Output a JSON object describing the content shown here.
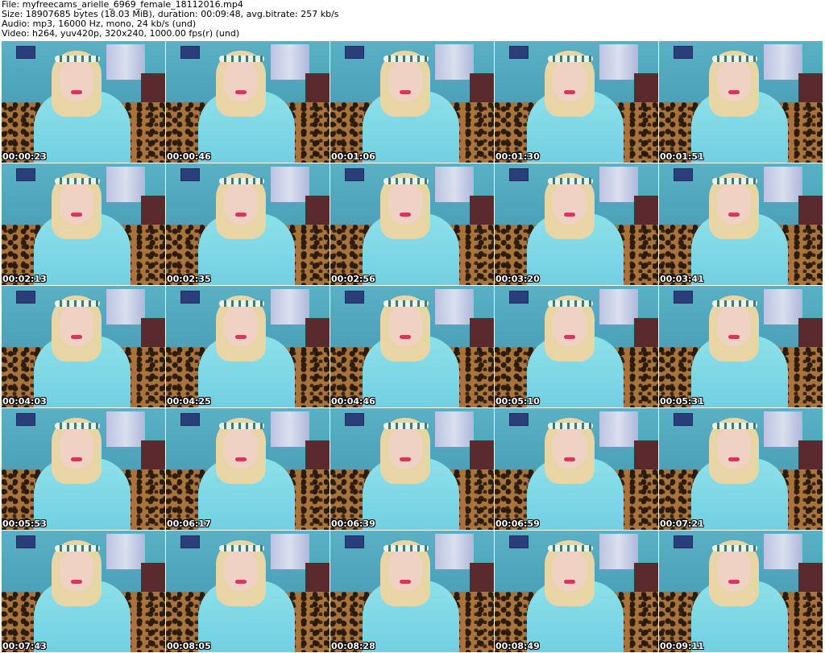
{
  "header": {
    "file_line": "File: myfreecams_arielle_6969_female_18112016.mp4",
    "size_line": "Size: 18907685 bytes (18.03 MiB), duration: 00:09:48, avg.bitrate: 257 kb/s",
    "audio_line": "Audio: mp3, 16000 Hz, mono, 24 kb/s (und)",
    "video_line": "Video: h264, yuv420p, 320x240, 1000.00 fps(r) (und)"
  },
  "thumbnails": [
    {
      "timestamp": "00:00:23"
    },
    {
      "timestamp": "00:00:46"
    },
    {
      "timestamp": "00:01:06"
    },
    {
      "timestamp": "00:01:30"
    },
    {
      "timestamp": "00:01:51"
    },
    {
      "timestamp": "00:02:13"
    },
    {
      "timestamp": "00:02:35"
    },
    {
      "timestamp": "00:02:56"
    },
    {
      "timestamp": "00:03:20"
    },
    {
      "timestamp": "00:03:41"
    },
    {
      "timestamp": "00:04:03"
    },
    {
      "timestamp": "00:04:25"
    },
    {
      "timestamp": "00:04:46"
    },
    {
      "timestamp": "00:05:10"
    },
    {
      "timestamp": "00:05:31"
    },
    {
      "timestamp": "00:05:53"
    },
    {
      "timestamp": "00:06:17"
    },
    {
      "timestamp": "00:06:39"
    },
    {
      "timestamp": "00:06:59"
    },
    {
      "timestamp": "00:07:21"
    },
    {
      "timestamp": "00:07:43"
    },
    {
      "timestamp": "00:08:05"
    },
    {
      "timestamp": "00:08:28"
    },
    {
      "timestamp": "00:08:49"
    },
    {
      "timestamp": "00:09:11"
    }
  ],
  "colors": {
    "background": "#ffffff",
    "header_text": "#000000",
    "timestamp_text": "#ffffff"
  }
}
